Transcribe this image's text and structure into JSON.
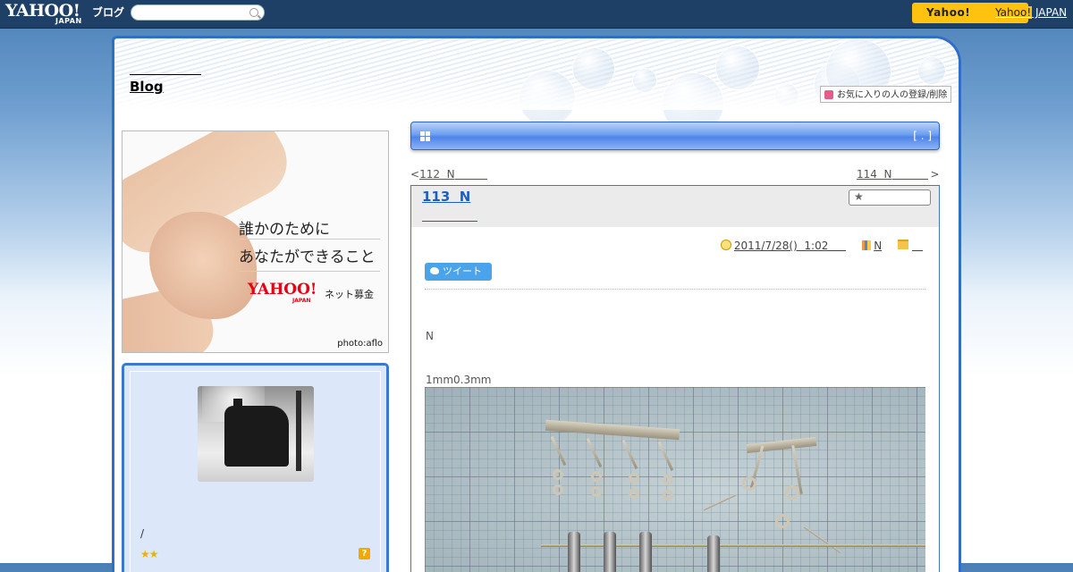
{
  "header": {
    "logo_text": "YAHOO!",
    "logo_sub": "JAPAN",
    "logo_blog": "ブログ",
    "search_placeholder": "",
    "promo_label": "Yahoo!",
    "yahoo_japan_link_prefix": "Yahoo!",
    "yahoo_japan_link_suffix": " JAPAN"
  },
  "blog": {
    "title": "Blog",
    "favorite_button": "お気に入りの人の登録/削除"
  },
  "sidebar": {
    "ad": {
      "line1": "誰かのために",
      "line2": "あなたができること",
      "brand": "YAHOO!",
      "brand_sub": "JAPAN",
      "service": "ネット募金",
      "credit": "photo:aflo"
    },
    "profile": {
      "slash_text": "/",
      "stars": "★★",
      "help_icon_label": "?"
    }
  },
  "main": {
    "section_bar_bracket": "[ . ]",
    "nav_prev_arrow": "<",
    "nav_prev_label": "112  N",
    "nav_next_label": "114  N",
    "nav_next_arrow": ">",
    "article": {
      "title": "113  N",
      "datetime": "2011/7/28()  1:02",
      "category": "N",
      "folder": "",
      "tweet_label": "ツイート",
      "text1": "N",
      "text2": "1mm0.3mm"
    }
  },
  "colors": {
    "topbar": "#1e3f66",
    "accent_blue": "#2f6fc6",
    "promo_yellow": "#ffc20e",
    "link_blue": "#1b5fc4",
    "twitter_blue": "#4ba3e9"
  },
  "icons": [
    "search-icon",
    "grid-icon",
    "star-icon",
    "clock-icon",
    "book-icon",
    "folder-icon",
    "twitter-bird-icon",
    "help-icon",
    "heart-icon"
  ]
}
